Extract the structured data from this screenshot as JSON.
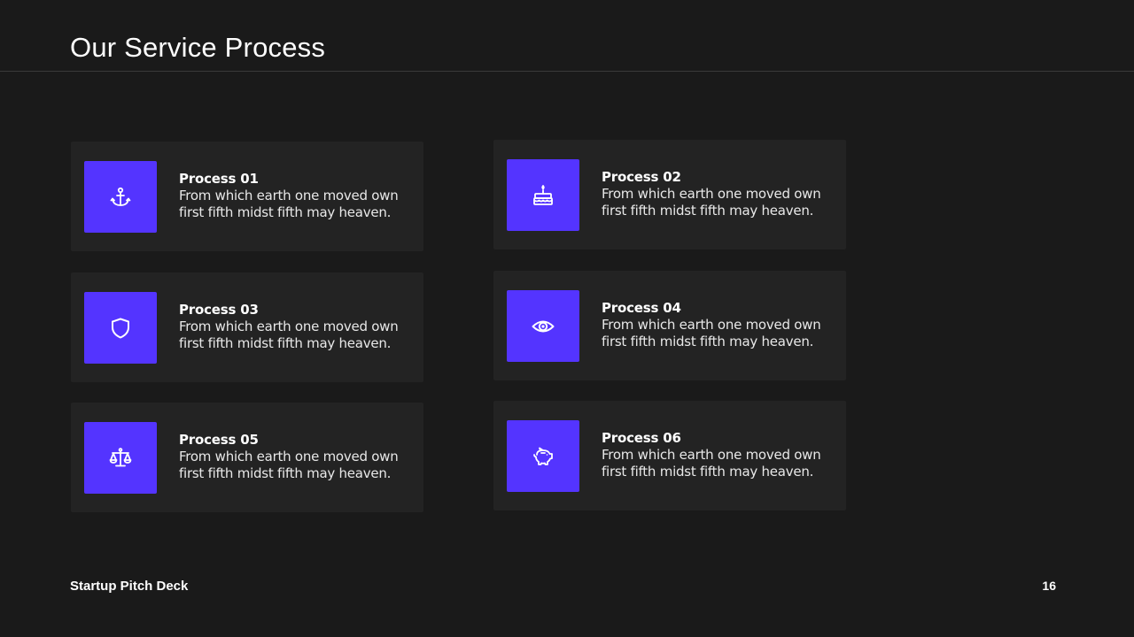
{
  "slide": {
    "title": "Our Service Process",
    "footer_brand": "Startup Pitch Deck",
    "page_number": "16"
  },
  "theme": {
    "background": "#1a1a1a",
    "card_background": "#232323",
    "accent": "#5434ff",
    "text": "#ffffff"
  },
  "processes": [
    {
      "title": "Process 01",
      "description": "From which earth one moved own first fifth midst fifth may heaven.",
      "icon": "anchor-icon"
    },
    {
      "title": "Process 02",
      "description": "From which earth one moved own first fifth midst fifth may heaven.",
      "icon": "cake-icon"
    },
    {
      "title": "Process 03",
      "description": "From which earth one moved own first fifth midst fifth may heaven.",
      "icon": "shield-icon"
    },
    {
      "title": "Process 04",
      "description": "From which earth one moved own first fifth midst fifth may heaven.",
      "icon": "eye-icon"
    },
    {
      "title": "Process 05",
      "description": "From which earth one moved own first fifth midst fifth may heaven.",
      "icon": "scale-icon"
    },
    {
      "title": "Process 06",
      "description": "From which earth one moved own first fifth midst fifth may heaven.",
      "icon": "piggy-bank-icon"
    }
  ]
}
